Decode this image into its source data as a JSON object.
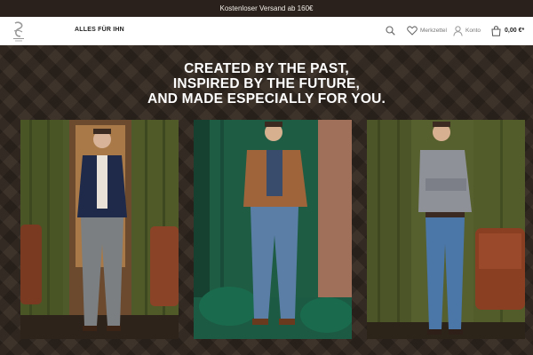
{
  "announcement": "Kostenloser Versand ab 160€",
  "header": {
    "logo": "brand-logo",
    "nav": [
      {
        "label": "ALLES FÜR IHN"
      }
    ],
    "search_icon": "search-icon",
    "wishlist_label": "Merkzettel",
    "account_label": "Konto",
    "cart_label": "0,00 €*"
  },
  "hero": {
    "headline": [
      "CREATED BY THE PAST,",
      "INSPIRED BY THE FUTURE,",
      "AND MADE ESPECIALLY FOR YOU."
    ],
    "photos": [
      {
        "alt": "Model in navy blazer and grey trousers in front of green curtains"
      },
      {
        "alt": "Model in brown suede jacket and jeans on green velvet backdrop"
      },
      {
        "alt": "Model in check shirt and blue jeans beside leather chair"
      }
    ]
  },
  "colors": {
    "topbar": "#2a211c",
    "hero_dark": "#2f2620",
    "curtain_green": "#4f5a2a",
    "velvet_green": "#1f5c44"
  }
}
